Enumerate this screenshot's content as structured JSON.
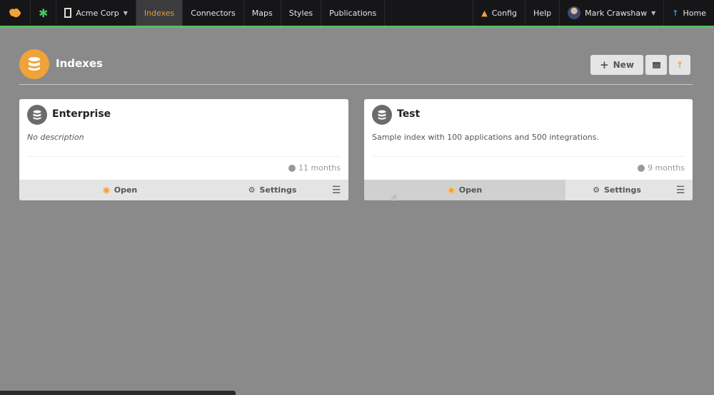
{
  "nav": {
    "org": "Acme Corp",
    "items": [
      "Indexes",
      "Connectors",
      "Maps",
      "Styles",
      "Publications"
    ],
    "active": "Indexes",
    "config": "Config",
    "help": "Help",
    "user": "Mark Crawshaw",
    "home": "Home"
  },
  "header": {
    "title": "Indexes",
    "new_label": "New"
  },
  "cards": [
    {
      "title": "Enterprise",
      "description": "No description",
      "updated": "11 months",
      "open": "Open",
      "settings": "Settings"
    },
    {
      "title": "Test",
      "description": "Sample index with 100 applications and 500 integrations.",
      "updated": "9 months",
      "open": "Open",
      "settings": "Settings"
    }
  ],
  "colors": {
    "accent": "#f0a33a",
    "nav_bg": "#161618",
    "success": "#52c062"
  }
}
